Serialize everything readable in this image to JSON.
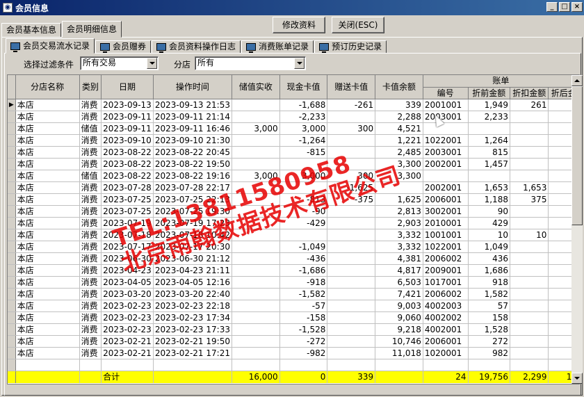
{
  "window": {
    "title": "会员信息"
  },
  "top_tabs": [
    {
      "label": "会员基本信息",
      "active": false
    },
    {
      "label": "会员明细信息",
      "active": true
    }
  ],
  "buttons": {
    "edit": "修改资料",
    "close": "关闭(ESC)"
  },
  "sub_tabs": [
    {
      "label": "会员交易流水记录",
      "active": true
    },
    {
      "label": "会员赠券",
      "active": false
    },
    {
      "label": "会员资料操作日志",
      "active": false
    },
    {
      "label": "消费账单记录",
      "active": false
    },
    {
      "label": "预订历史记录",
      "active": false
    }
  ],
  "filter": {
    "label": "选择过滤条件",
    "value": "所有交易",
    "branch_label": "分店",
    "branch_value": "所有"
  },
  "table": {
    "group_header": "账单",
    "columns": [
      "分店名称",
      "类别",
      "日期",
      "操作时间",
      "储值实收",
      "现金卡值",
      "赠送卡值",
      "卡值余额",
      "编号",
      "折前金额",
      "折扣金额",
      "折后金"
    ],
    "rows": [
      [
        "本店",
        "消费",
        "2023-09-13",
        "2023-09-13 21:53",
        "",
        "-1,688",
        "-261",
        "339",
        "2001001",
        "1,949",
        "261",
        "1"
      ],
      [
        "本店",
        "消费",
        "2023-09-11",
        "2023-09-11 21:14",
        "",
        "-2,233",
        "",
        "2,288",
        "2003001",
        "2,233",
        "",
        "2"
      ],
      [
        "本店",
        "储值",
        "2023-09-11",
        "2023-09-11 16:46",
        "3,000",
        "3,000",
        "300",
        "4,521",
        "",
        "",
        "",
        ""
      ],
      [
        "本店",
        "消费",
        "2023-09-10",
        "2023-09-10 21:30",
        "",
        "-1,264",
        "",
        "1,221",
        "1022001",
        "1,264",
        "",
        "1"
      ],
      [
        "本店",
        "消费",
        "2023-08-22",
        "2023-08-22 20:45",
        "",
        "-815",
        "",
        "2,485",
        "2003001",
        "815",
        "",
        ""
      ],
      [
        "本店",
        "消费",
        "2023-08-22",
        "2023-08-22 19:50",
        "",
        "",
        "",
        "3,300",
        "2002001",
        "1,457",
        "",
        "1"
      ],
      [
        "本店",
        "储值",
        "2023-08-22",
        "2023-08-22 19:16",
        "3,000",
        "3,000",
        "300",
        "3,300",
        "",
        "",
        "",
        ""
      ],
      [
        "本店",
        "消费",
        "2023-07-28",
        "2023-07-28 22:17",
        "",
        "",
        "-1,625",
        "",
        "2002001",
        "1,653",
        "1,653",
        ""
      ],
      [
        "本店",
        "消费",
        "2023-07-25",
        "2023-07-25 22:13",
        "",
        "-813",
        "-375",
        "1,625",
        "2006001",
        "1,188",
        "375",
        "1"
      ],
      [
        "本店",
        "消费",
        "2023-07-25",
        "2023-07-25 19:30",
        "",
        "-90",
        "",
        "2,813",
        "3002001",
        "90",
        "",
        ""
      ],
      [
        "本店",
        "消费",
        "2023-07-19",
        "2023-07-19 17:23",
        "",
        "-429",
        "",
        "2,903",
        "2010001",
        "429",
        "",
        ""
      ],
      [
        "本店",
        "消费",
        "2023-07-18",
        "2023-07-18 10:42",
        "",
        "",
        "",
        "3,332",
        "1001001",
        "10",
        "10",
        ""
      ],
      [
        "本店",
        "消费",
        "2023-07-17",
        "2023-07-17 20:30",
        "",
        "-1,049",
        "",
        "3,332",
        "1022001",
        "1,049",
        "",
        "1"
      ],
      [
        "本店",
        "消费",
        "2023-06-30",
        "2023-06-30 21:12",
        "",
        "-436",
        "",
        "4,381",
        "2006002",
        "436",
        "",
        ""
      ],
      [
        "本店",
        "消费",
        "2023-04-23",
        "2023-04-23 21:11",
        "",
        "-1,686",
        "",
        "4,817",
        "2009001",
        "1,686",
        "",
        "1"
      ],
      [
        "本店",
        "消费",
        "2023-04-05",
        "2023-04-05 12:16",
        "",
        "-918",
        "",
        "6,503",
        "1017001",
        "918",
        "",
        ""
      ],
      [
        "本店",
        "消费",
        "2023-03-20",
        "2023-03-20 22:40",
        "",
        "-1,582",
        "",
        "7,421",
        "2006002",
        "1,582",
        "",
        "1"
      ],
      [
        "本店",
        "消费",
        "2023-02-23",
        "2023-02-23 22:18",
        "",
        "-57",
        "",
        "9,003",
        "4002003",
        "57",
        "",
        ""
      ],
      [
        "本店",
        "消费",
        "2023-02-23",
        "2023-02-23 17:34",
        "",
        "-158",
        "",
        "9,060",
        "4002002",
        "158",
        "",
        ""
      ],
      [
        "本店",
        "消费",
        "2023-02-23",
        "2023-02-23 17:33",
        "",
        "-1,528",
        "",
        "9,218",
        "4002001",
        "1,528",
        "",
        "1"
      ],
      [
        "本店",
        "消费",
        "2023-02-21",
        "2023-02-21 19:50",
        "",
        "-272",
        "",
        "10,746",
        "2006001",
        "272",
        "",
        ""
      ],
      [
        "本店",
        "消费",
        "2023-02-21",
        "2023-02-21 17:21",
        "",
        "-982",
        "",
        "11,018",
        "1020001",
        "982",
        "",
        ""
      ]
    ],
    "totals": [
      "",
      "",
      "合计",
      "",
      "16,000",
      "0",
      "339",
      "",
      "24",
      "19,756",
      "2,299",
      "17"
    ]
  },
  "watermark": {
    "line1": "TEL:13811580958",
    "line2": "北京雨翰数据技术有限公司"
  }
}
